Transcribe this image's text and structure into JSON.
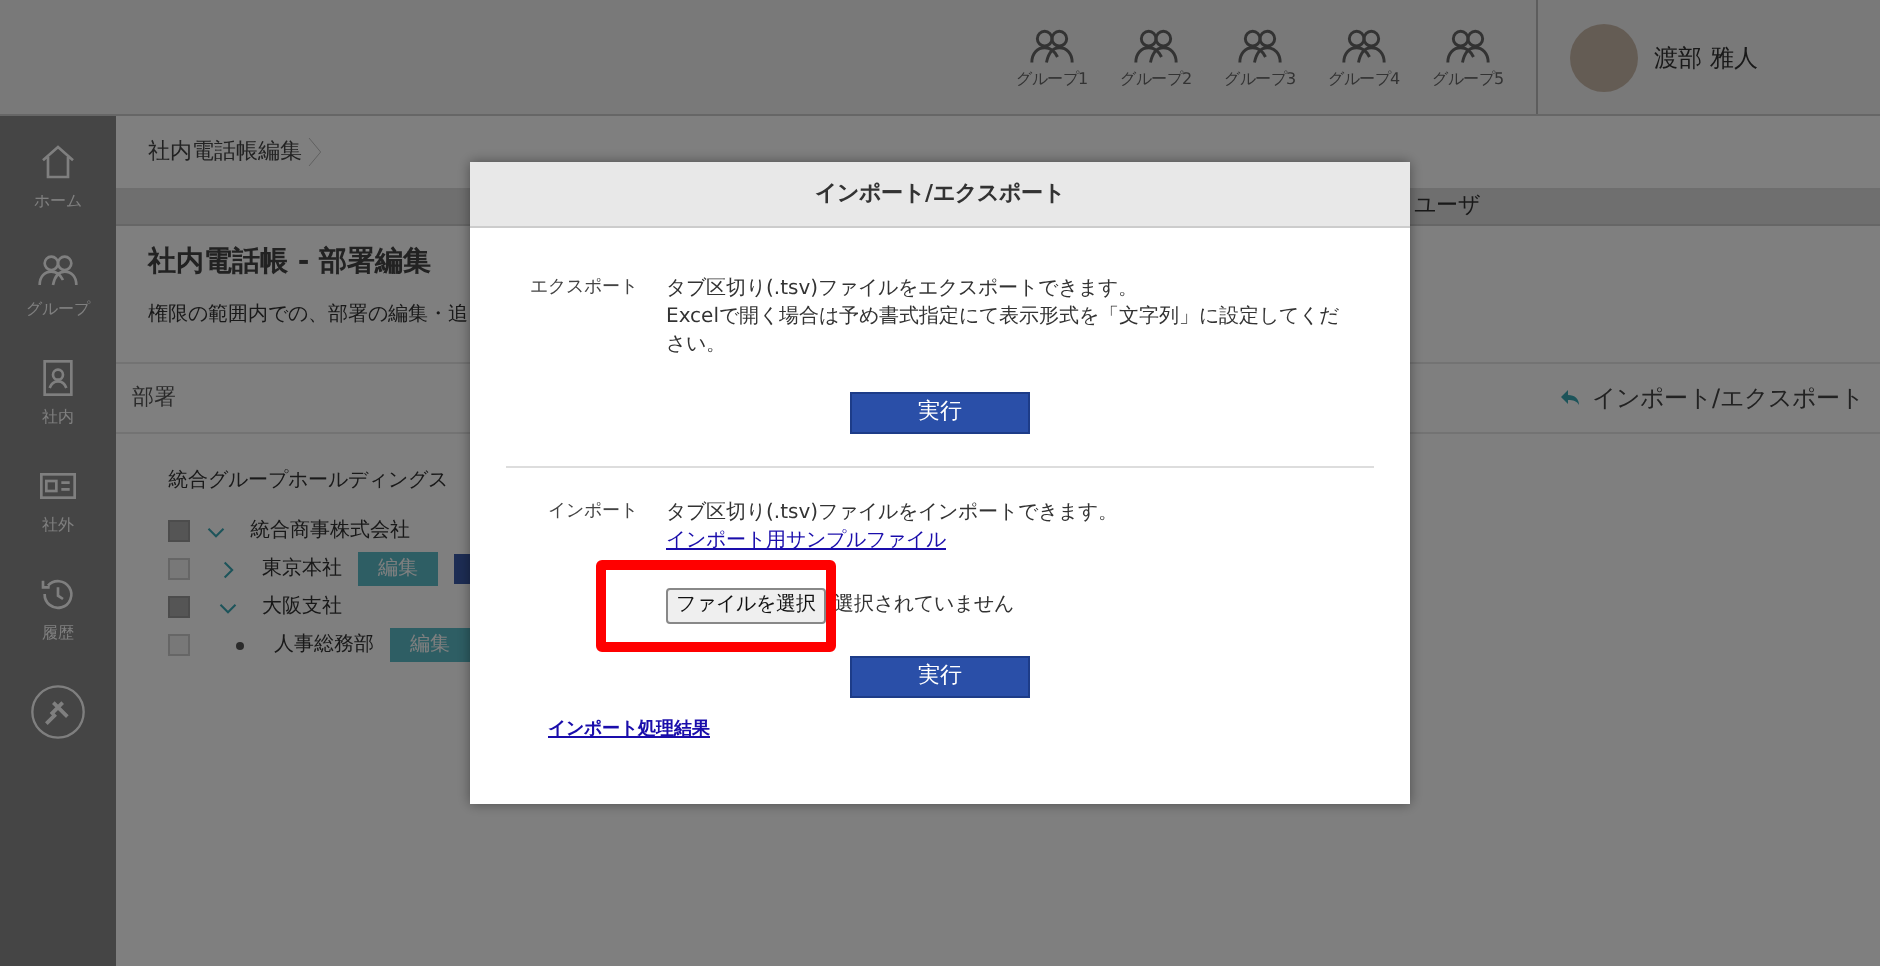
{
  "header": {
    "groups": [
      "グループ1",
      "グループ2",
      "グループ3",
      "グループ4",
      "グループ5"
    ],
    "user_name": "渡部 雅人"
  },
  "sidebar": {
    "items": [
      {
        "label": "ホーム",
        "kind": "home"
      },
      {
        "label": "グループ",
        "kind": "group"
      },
      {
        "label": "社内",
        "kind": "internal"
      },
      {
        "label": "社外",
        "kind": "external"
      },
      {
        "label": "履歴",
        "kind": "history"
      }
    ]
  },
  "breadcrumb": "社内電話帳編集",
  "tabs": [
    {
      "label": "ユーザ",
      "selected": false
    }
  ],
  "page": {
    "title": "社内電話帳 - 部署編集",
    "description": "権限の範囲内での、部署の編集・追",
    "section_label": "部署",
    "import_export_link": "インポート/エクスポート"
  },
  "tree": {
    "root": "統合グループホールディングス",
    "nodes": [
      {
        "name": "統合商事株式会社",
        "checked": true,
        "expanded": true,
        "children": [
          {
            "name": "東京本社",
            "checked": false,
            "expanded": false,
            "buttons": [
              {
                "label": "編集",
                "kind": "edit"
              },
              {
                "kind": "other"
              }
            ]
          },
          {
            "name": "大阪支社",
            "checked": true,
            "expanded": true,
            "children": [
              {
                "name": "人事総務部",
                "checked": false,
                "leaf": true,
                "buttons": [
                  {
                    "label": "編集",
                    "kind": "edit"
                  }
                ]
              }
            ]
          }
        ]
      }
    ]
  },
  "dialog": {
    "title": "インポート/エクスポート",
    "export": {
      "label": "エクスポート",
      "lines": [
        "タブ区切り(.tsv)ファイルをエクスポートできます。",
        "Excelで開く場合は予め書式指定にて表示形式を「文字列」に設定してください。"
      ],
      "button": "実行"
    },
    "import": {
      "label": "インポート",
      "text": "タブ区切り(.tsv)ファイルをインポートできます。",
      "sample_link": "インポート用サンプルファイル",
      "file_button": "ファイルを選択",
      "file_status": "選択されていません",
      "highlighted": true,
      "button": "実行"
    },
    "result_link": "インポート処理結果"
  }
}
